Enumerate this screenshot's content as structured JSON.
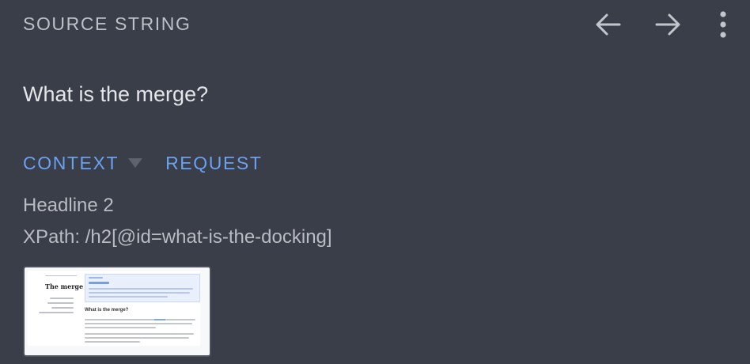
{
  "header": {
    "title": "SOURCE STRING",
    "icons": [
      "arrow-left-icon",
      "arrow-right-icon",
      "more-vertical-icon"
    ]
  },
  "source": {
    "text": "What is the merge?"
  },
  "tabs": [
    {
      "label": "CONTEXT"
    },
    {
      "label": "REQUEST"
    }
  ],
  "context": {
    "element_type": "Headline 2",
    "xpath": "XPath: /h2[@id=what-is-the-docking]"
  },
  "screenshot_thumbnail": {
    "sidebar_title": "The merge",
    "heading": "What is the merge?"
  },
  "colors": {
    "background": "#393e48",
    "accent": "#6aa1f2",
    "text_primary": "#e3e5e8",
    "text_secondary": "#b9bcc2"
  }
}
